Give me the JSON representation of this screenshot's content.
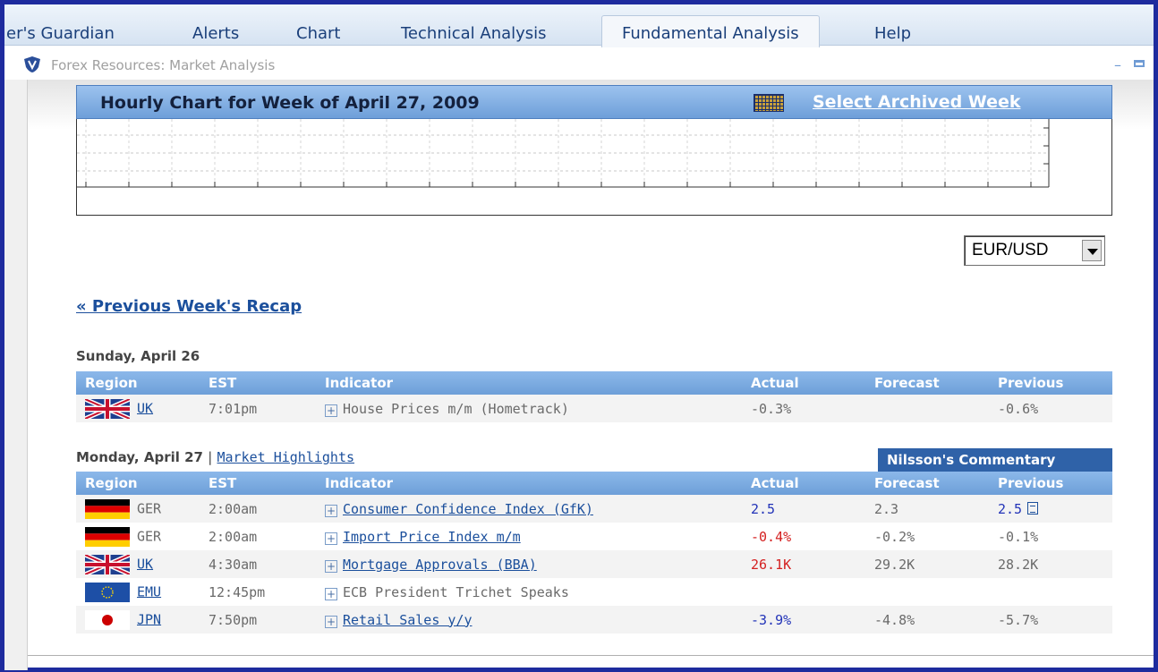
{
  "tabs": [
    {
      "label": "er's Guardian"
    },
    {
      "label": "Alerts"
    },
    {
      "label": "Chart"
    },
    {
      "label": "Technical Analysis"
    },
    {
      "label": "Fundamental Analysis",
      "active": true
    },
    {
      "label": "Help"
    }
  ],
  "window": {
    "title": "Forex Resources: Market Analysis"
  },
  "chart_panel": {
    "title": "Hourly Chart for Week of April 27, 2009",
    "archive_link": "Select Archived Week"
  },
  "pair_select": {
    "value": "EUR/USD"
  },
  "recap_link": "« Previous Week's Recap",
  "columns": [
    "Region",
    "EST",
    "Indicator",
    "Actual",
    "Forecast",
    "Previous"
  ],
  "days": [
    {
      "label": "Sunday, April 26",
      "rows": [
        {
          "flag": "uk",
          "region": "UK",
          "region_link": true,
          "time": "7:01pm",
          "indicator": "House Prices m/m (Hometrack)",
          "indicator_link": false,
          "actual": "-0.3%",
          "forecast": "",
          "previous": "-0.6%"
        }
      ]
    },
    {
      "label": "Monday, April 27",
      "separator": "|",
      "highlights_link": "Market Highlights",
      "commentary_button": "Nilsson's Commentary",
      "rows": [
        {
          "flag": "de",
          "region": "GER",
          "region_link": false,
          "time": "2:00am",
          "indicator": "Consumer Confidence Index (GfK)",
          "indicator_link": true,
          "actual": "2.5",
          "forecast": "2.3",
          "previous": "2.5"
        },
        {
          "flag": "de",
          "region": "GER",
          "region_link": false,
          "time": "2:00am",
          "indicator": "Import Price Index m/m",
          "indicator_link": true,
          "actual": "-0.4%",
          "forecast": "-0.2%",
          "previous": "-0.1%"
        },
        {
          "flag": "uk",
          "region": "UK",
          "region_link": true,
          "time": "4:30am",
          "indicator": "Mortgage Approvals (BBA)",
          "indicator_link": true,
          "actual": "26.1K",
          "forecast": "29.2K",
          "previous": "28.2K"
        },
        {
          "flag": "eu",
          "region": "EMU",
          "region_link": true,
          "time": "12:45pm",
          "indicator": "ECB President Trichet Speaks",
          "indicator_link": false,
          "actual": "",
          "forecast": "",
          "previous": ""
        },
        {
          "flag": "jp",
          "region": "JPN",
          "region_link": true,
          "time": "7:50pm",
          "indicator": "Retail Sales y/y",
          "indicator_link": true,
          "actual": "-3.9%",
          "forecast": "-4.8%",
          "previous": "-5.7%"
        }
      ]
    }
  ],
  "colors": {
    "frame": "#1e2b9e",
    "header_blue": "#6d9fd8",
    "link_blue": "#1b4f9c",
    "actual_positive": "#2233b8",
    "actual_negative": "#d42020",
    "muted_text": "#6a6a6a"
  },
  "icons": {
    "logo": "shield-logo-icon",
    "calendar": "calendar-icon",
    "expand": "plus-box-icon",
    "revision": "revision-icon"
  }
}
